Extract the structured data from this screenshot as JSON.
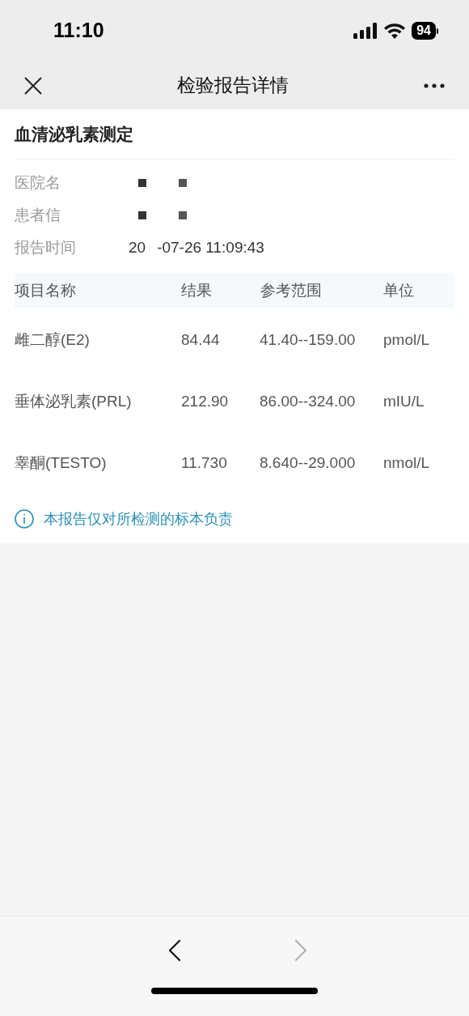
{
  "status_bar": {
    "time": "11:10",
    "battery": "94"
  },
  "nav": {
    "title": "检验报告详情"
  },
  "report": {
    "title": "血清泌乳素测定",
    "info": [
      {
        "label": "医院名"
      },
      {
        "label": "患者信"
      },
      {
        "label": "报告时间",
        "value_parts": [
          "20",
          "-07-26 11:09:43"
        ]
      }
    ],
    "table": {
      "columns": [
        "项目名称",
        "结果",
        "参考范围",
        "单位"
      ],
      "rows": [
        [
          "雌二醇(E2)",
          "84.44",
          "41.40--159.00",
          "pmol/L"
        ],
        [
          "垂体泌乳素(PRL)",
          "212.90",
          "86.00--324.00",
          "mIU/L"
        ],
        [
          "睾酮(TESTO)",
          "11.730",
          "8.640--29.000",
          "nmol/L"
        ]
      ]
    },
    "notice": "本报告仅对所检测的标本负责"
  },
  "bottom_bar": {
    "back": {
      "disabled": false
    },
    "forward": {
      "disabled": true
    }
  }
}
